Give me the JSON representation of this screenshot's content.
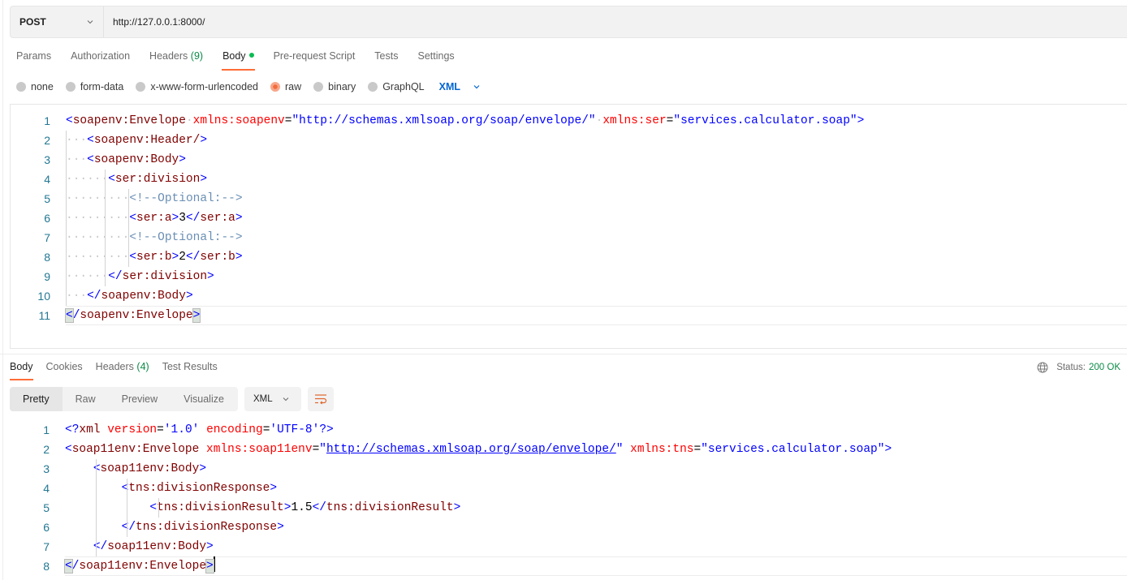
{
  "request": {
    "method": "POST",
    "url": "http://127.0.0.1:8000/",
    "tabs": [
      {
        "label": "Params"
      },
      {
        "label": "Authorization"
      },
      {
        "label": "Headers",
        "count": "(9)"
      },
      {
        "label": "Body",
        "active": true
      },
      {
        "label": "Pre-request Script"
      },
      {
        "label": "Tests"
      },
      {
        "label": "Settings"
      }
    ],
    "body_types": [
      "none",
      "form-data",
      "x-www-form-urlencoded",
      "raw",
      "binary",
      "GraphQL"
    ],
    "selected_body_type": "raw",
    "language": "XML",
    "code_lines": [
      "<soapenv:Envelope xmlns:soapenv=\"http://schemas.xmlsoap.org/soap/envelope/\" xmlns:ser=\"services.calculator.soap\">",
      "   <soapenv:Header/>",
      "   <soapenv:Body>",
      "      <ser:division>",
      "         <!--Optional:-->",
      "         <ser:a>3</ser:a>",
      "         <!--Optional:-->",
      "         <ser:b>2</ser:b>",
      "      </ser:division>",
      "   </soapenv:Body>",
      "</soapenv:Envelope>"
    ]
  },
  "response": {
    "tabs": [
      {
        "label": "Body",
        "active": true
      },
      {
        "label": "Cookies"
      },
      {
        "label": "Headers",
        "count": "(4)"
      },
      {
        "label": "Test Results"
      }
    ],
    "status_label": "Status:",
    "status_value": "200 OK",
    "views": [
      "Pretty",
      "Raw",
      "Preview",
      "Visualize"
    ],
    "active_view": "Pretty",
    "language": "XML",
    "code_lines": [
      "<?xml version='1.0' encoding='UTF-8'?>",
      "<soap11env:Envelope xmlns:soap11env=\"http://schemas.xmlsoap.org/soap/envelope/\" xmlns:tns=\"services.calculator.soap\">",
      "    <soap11env:Body>",
      "        <tns:divisionResponse>",
      "            <tns:divisionResult>1.5</tns:divisionResult>",
      "        </tns:divisionResponse>",
      "    </soap11env:Body>",
      "</soap11env:Envelope>"
    ]
  },
  "colors": {
    "accent": "#ff6c37",
    "status_ok": "#0b8a47",
    "xml_bracket": "#0000ff",
    "xml_tag": "#800000",
    "xml_attr": "#ff0000",
    "xml_comment": "#6a8fb4"
  }
}
